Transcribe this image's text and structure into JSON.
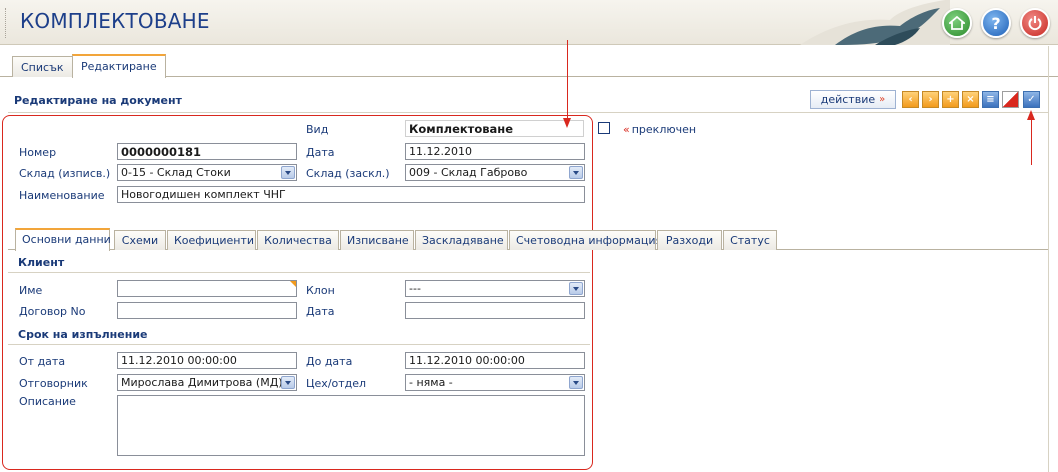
{
  "header": {
    "title": "КОМПЛЕКТОВАНЕ"
  },
  "top_tabs": [
    "Списък",
    "Редактиране"
  ],
  "panel": {
    "title": "Редактиране на документ",
    "action_label": "действие",
    "action_arrow": "»"
  },
  "toolbar_icons": [
    "prev-icon",
    "next-icon",
    "add-icon",
    "delete-icon",
    "print-icon",
    "flag-icon",
    "check-icon"
  ],
  "form": {
    "vid_label": "Вид",
    "vid_value": "Комплектоване",
    "switched_label": "преключен",
    "switched_prefix": "«",
    "nomer_label": "Номер",
    "nomer_value": "0000000181",
    "data_label": "Дата",
    "data_value": "11.12.2010",
    "sklad_izpisv_label": "Склад (изписв.)",
    "sklad_izpisv_value": "0-15 - Склад Стоки",
    "sklad_zaskl_label": "Склад (заскл.)",
    "sklad_zaskl_value": "009 - Склад Габрово",
    "naim_label": "Наименование",
    "naim_value": "Новогодишен комплект ЧНГ"
  },
  "inner_tabs": [
    "Основни данни",
    "Схеми",
    "Коефициенти",
    "Количества",
    "Изписване",
    "Заскладяване",
    "Счетоводна информация",
    "Разходи",
    "Статус"
  ],
  "client": {
    "title": "Клиент",
    "ime_label": "Име",
    "ime_value": "",
    "klon_label": "Клон",
    "klon_value": "---",
    "dogovor_label": "Договор No",
    "dogovor_value": "",
    "data_label": "Дата",
    "data_value": ""
  },
  "term": {
    "title": "Срок на изпълнение",
    "ot_label": "От дата",
    "ot_value": "11.12.2010 00:00:00",
    "do_label": "До дата",
    "do_value": "11.12.2010 00:00:00",
    "otg_label": "Отговорник",
    "otg_value": "Мирослава Димитрова (МД)",
    "ceh_label": "Цех/отдел",
    "ceh_value": "- няма -",
    "opisanie_label": "Описание",
    "opisanie_value": ""
  },
  "colors": {
    "accent_red": "#d9281e",
    "tab_accent": "#f2a53a",
    "text_blue": "#1a3a78"
  }
}
